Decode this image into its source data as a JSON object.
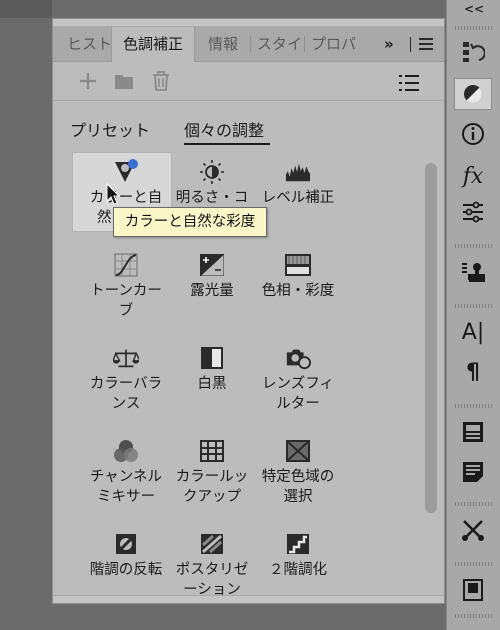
{
  "dock": {
    "collapse_label": "<<",
    "items": [
      {
        "icon": "history-icon"
      },
      {
        "icon": "adjustments-icon"
      },
      {
        "icon": "info-icon"
      },
      {
        "icon": "fx-styles-icon",
        "label": "fx"
      },
      {
        "icon": "sliders-icon"
      },
      {
        "icon": "stamp-icon"
      },
      {
        "icon": "character-icon",
        "label": "A|"
      },
      {
        "icon": "paragraph-icon",
        "label": "¶"
      },
      {
        "icon": "glyphs-icon"
      },
      {
        "icon": "notes-icon"
      },
      {
        "icon": "tools-icon"
      },
      {
        "icon": "book-icon"
      }
    ]
  },
  "tabs": [
    {
      "label": "ヒスト"
    },
    {
      "label": "色調補正"
    },
    {
      "label": "情報"
    },
    {
      "label": "スタイ"
    },
    {
      "label": "プロパ"
    }
  ],
  "tab_overflow_label": "»",
  "toolbar": {
    "add_icon": "plus-icon",
    "folder_icon": "folder-icon",
    "delete_icon": "trash-icon",
    "view_icon": "list-view-icon"
  },
  "subtabs": [
    {
      "label": "プリセット"
    },
    {
      "label": "個々の調整"
    }
  ],
  "adjustments": [
    {
      "label": "カラーと自\n然な彩度",
      "icon": "vibrance-icon"
    },
    {
      "label": "明るさ・コ\n",
      "icon": "brightness-icon"
    },
    {
      "label": "レベル補正",
      "icon": "levels-icon"
    },
    {
      "label": "トーンカー\nブ",
      "icon": "curves-icon"
    },
    {
      "label": "露光量",
      "icon": "exposure-icon"
    },
    {
      "label": "色相・彩度",
      "icon": "hue-saturation-icon"
    },
    {
      "label": "カラーバラ\nンス",
      "icon": "color-balance-icon"
    },
    {
      "label": "白黒",
      "icon": "black-white-icon"
    },
    {
      "label": "レンズフィ\nルター",
      "icon": "photo-filter-icon"
    },
    {
      "label": "チャンネル\nミキサー",
      "icon": "channel-mixer-icon"
    },
    {
      "label": "カラールッ\nクアップ",
      "icon": "color-lookup-icon"
    },
    {
      "label": "特定色域の\n選択",
      "icon": "selective-color-icon"
    },
    {
      "label": "階調の反転",
      "icon": "invert-icon"
    },
    {
      "label": "ポスタリゼ\nーション",
      "icon": "posterize-icon"
    },
    {
      "label": "２階調化",
      "icon": "threshold-icon"
    }
  ],
  "tooltip": "カラーと自然な彩度",
  "colors": {
    "accent": "#3b6fd8",
    "panel": "#bcbcbc",
    "tooltip_bg": "#fbf7c8"
  }
}
